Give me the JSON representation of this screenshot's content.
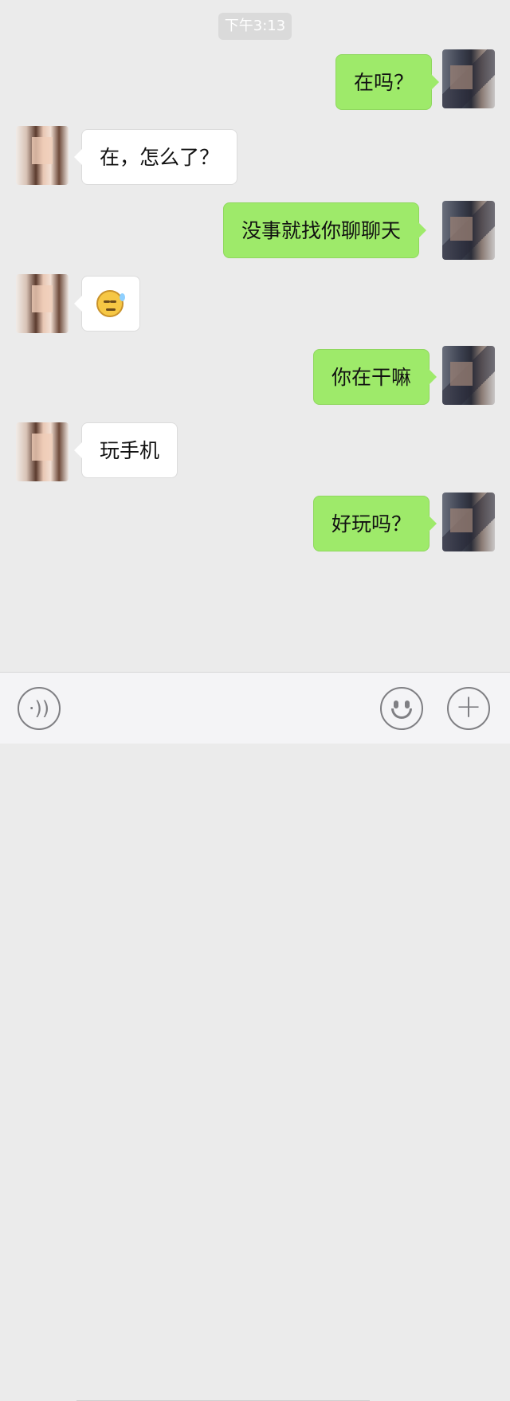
{
  "timestamp": "下午3:13",
  "messages": [
    {
      "side": "right",
      "text": "在吗？"
    },
    {
      "side": "left",
      "text": "在，怎么了？"
    },
    {
      "side": "right",
      "text": "没事就找你聊聊天"
    },
    {
      "side": "left",
      "emoji": "sweat-smile-emoji"
    },
    {
      "side": "right",
      "text": "你在干嘛"
    },
    {
      "side": "left",
      "text": "玩手机"
    },
    {
      "side": "right",
      "text": "好玩吗？"
    }
  ],
  "input_bar": {
    "voice_icon": "voice-icon",
    "emoji_icon": "emoji-icon",
    "plus_icon": "plus-icon",
    "voice_glyph": "·))",
    "plus_glyph": "+"
  },
  "colors": {
    "background": "#ebebeb",
    "outgoing_bubble": "#9eea6a",
    "incoming_bubble": "#ffffff"
  }
}
